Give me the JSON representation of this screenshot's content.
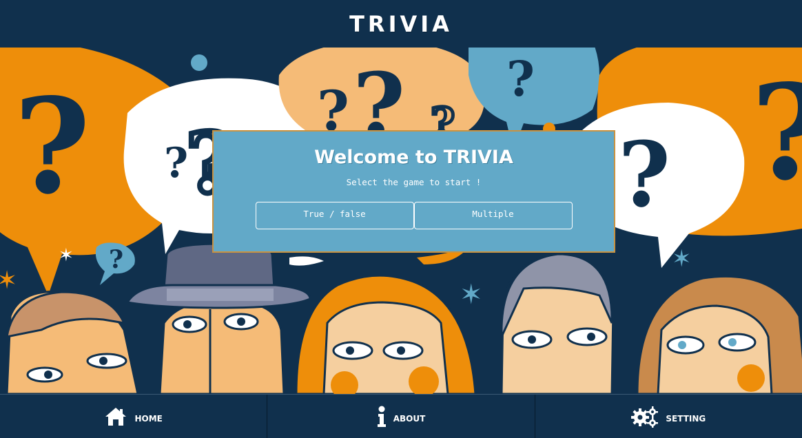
{
  "header": {
    "title": "TRIVIA"
  },
  "dialog": {
    "title": "Welcome to TRIVIA",
    "subtitle": "Select the game to start !",
    "buttons": [
      "True / false",
      "Multiple"
    ]
  },
  "footer": {
    "items": [
      {
        "label": "Home",
        "icon": "home-icon"
      },
      {
        "label": "About",
        "icon": "info-icon"
      },
      {
        "label": "Setting",
        "icon": "gears-icon"
      }
    ]
  },
  "colors": {
    "navy": "#10304d",
    "dialog": "#62a9c8",
    "dialog_border": "#c99240",
    "orange": "#ee8e0a",
    "peach": "#f5bb77",
    "light_blue": "#62a9c8"
  }
}
